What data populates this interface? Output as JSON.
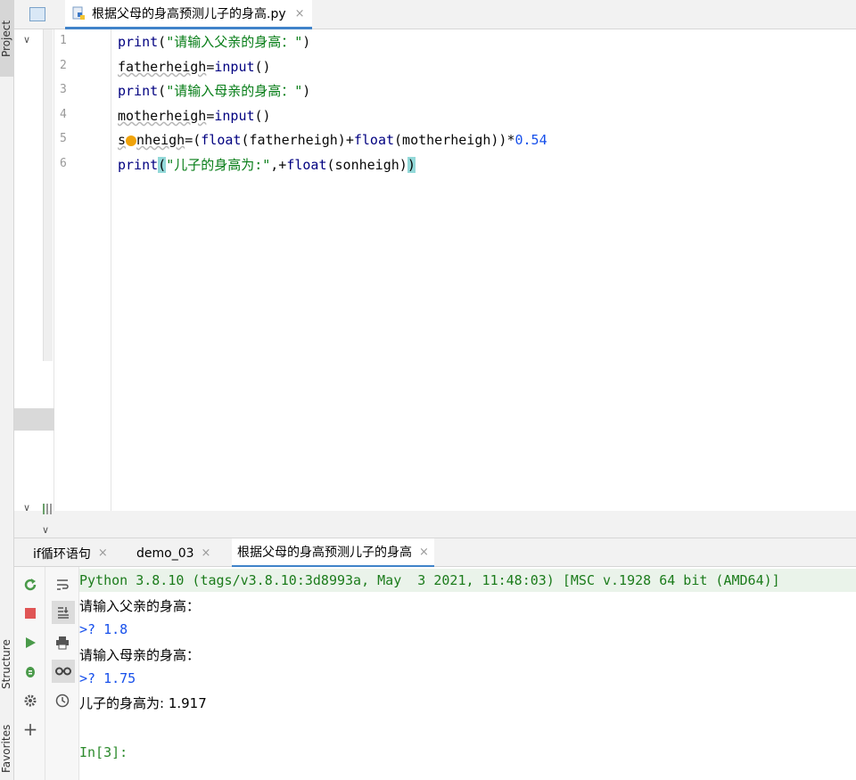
{
  "sidebar": {
    "project_tab": "Project",
    "structure_tab": "Structure",
    "favorites_tab": "Favorites"
  },
  "editor": {
    "tab_title": "根据父母的身高预测儿子的身高.py",
    "tab_close": "×",
    "project_tab_hint": ".",
    "line_numbers": [
      "1",
      "2",
      "3",
      "4",
      "5",
      "6"
    ],
    "lines": {
      "l1": {
        "fn": "print",
        "open": "(",
        "str": "\"请输入父亲的身高：\"",
        "close": ")"
      },
      "l2": {
        "var": "fatherheigh",
        "eq": "=",
        "fn": "input",
        "parens": "()"
      },
      "l3": {
        "fn": "print",
        "open": "(",
        "str": "\"请输入母亲的身高：\"",
        "close": ")"
      },
      "l4": {
        "var": "motherheigh",
        "eq": "=",
        "fn": "input",
        "parens": "()"
      },
      "l5": {
        "var_a": "s",
        "var_b": "nheigh",
        "eq": "=(",
        "f1": "float",
        "arg1": "(fatherheigh)+",
        "f2": "float",
        "arg2": "(motherheigh))*",
        "num": "0.54"
      },
      "l6": {
        "fn": "print",
        "open": "(",
        "str": "\"儿子的身高为:\"",
        "mid": ",+",
        "f": "float",
        "arg": "(sonheigh)",
        "close": ")"
      }
    }
  },
  "run_window": {
    "tabs": [
      {
        "label": "if循环语句",
        "close": "×"
      },
      {
        "label": "demo_03",
        "close": "×"
      },
      {
        "label": "根据父母的身高预测儿子的身高",
        "close": "×"
      }
    ],
    "console": {
      "header": "Python 3.8.10 (tags/v3.8.10:3d8993a, May  3 2021, 11:48:03) [MSC v.1928 64 bit (AMD64)]",
      "prompt1": "请输入父亲的身高：",
      "input1": ">? 1.8",
      "prompt2": "请输入母亲的身高：",
      "input2": ">? 1.75",
      "result": "儿子的身高为: 1.917",
      "in_prompt": "In[3]:"
    }
  },
  "colors": {
    "accent": "#4083c9",
    "string": "#067d17",
    "builtin": "#000080",
    "number": "#1750eb",
    "paren_highlight": "#93d9d9"
  }
}
